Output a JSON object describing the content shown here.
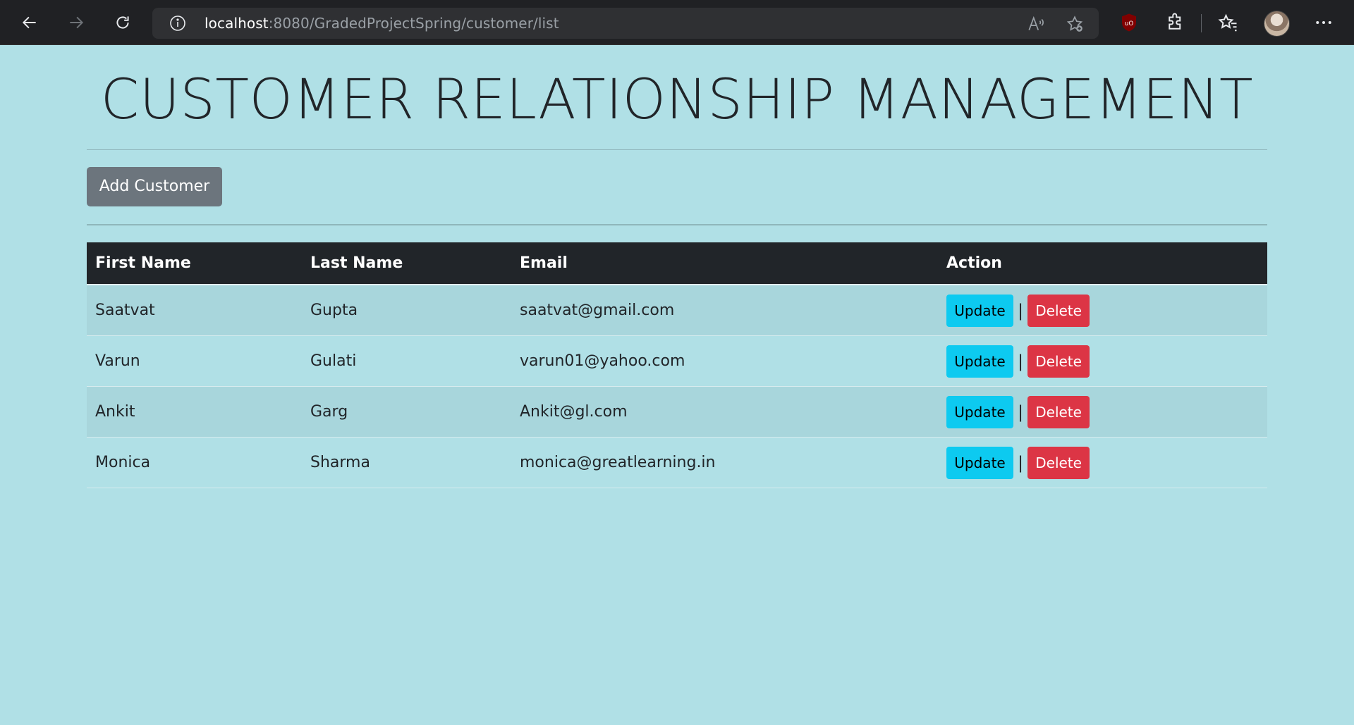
{
  "browser": {
    "url_host": "localhost",
    "url_path": ":8080/GradedProjectSpring/customer/list"
  },
  "page": {
    "title": "CUSTOMER RELATIONSHIP MANAGEMENT",
    "add_button_label": "Add Customer"
  },
  "table": {
    "headers": [
      "First Name",
      "Last Name",
      "Email",
      "Action"
    ],
    "rows": [
      {
        "first": "Saatvat",
        "last": "Gupta",
        "email": "saatvat@gmail.com"
      },
      {
        "first": "Varun",
        "last": "Gulati",
        "email": "varun01@yahoo.com"
      },
      {
        "first": "Ankit",
        "last": "Garg",
        "email": "Ankit@gl.com"
      },
      {
        "first": "Monica",
        "last": "Sharma",
        "email": "monica@greatlearning.in"
      }
    ],
    "update_label": "Update",
    "delete_label": "Delete",
    "separator": "|"
  },
  "icons": {
    "back": "back-arrow-icon",
    "forward": "forward-arrow-icon",
    "refresh": "refresh-icon",
    "info": "info-icon",
    "read_aloud": "read-aloud-icon",
    "add_favorite": "add-favorite-icon",
    "ublock": "ublock-icon",
    "extensions": "extensions-icon",
    "favorites": "favorites-icon",
    "more": "more-icon"
  },
  "colors": {
    "page_bg": "#b0e0e6",
    "header_bg": "#212529",
    "update_btn": "#0dcaf0",
    "delete_btn": "#dc3545",
    "add_btn": "#6c757d"
  }
}
